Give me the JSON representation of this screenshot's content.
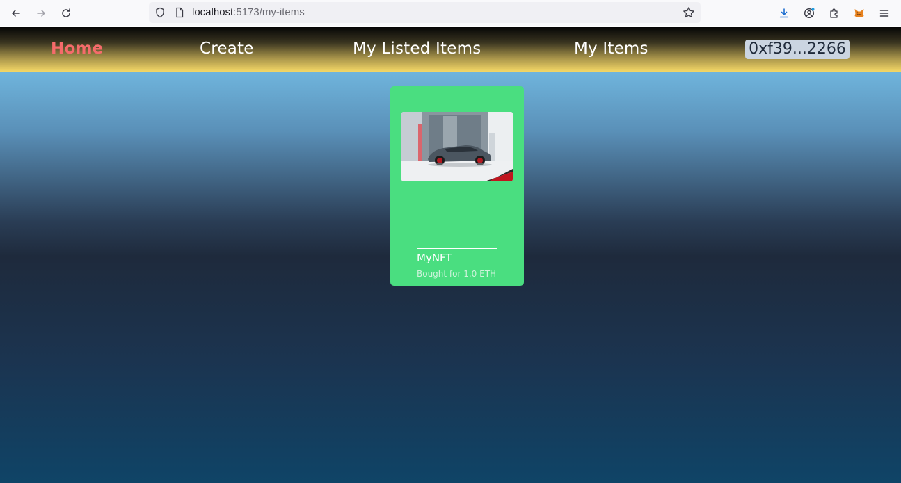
{
  "browser": {
    "url_host": "localhost",
    "url_path": ":5173/my-items"
  },
  "navbar": {
    "items": [
      {
        "label": "Home",
        "active": true
      },
      {
        "label": "Create",
        "active": false
      },
      {
        "label": "My Listed Items",
        "active": false
      },
      {
        "label": "My Items",
        "active": false
      }
    ],
    "wallet_label": "0xf39...2266"
  },
  "items": [
    {
      "title": "MyNFT",
      "price_text": "Bought for 1.0 ETH",
      "image_icon": "car-photo"
    }
  ],
  "colors": {
    "card": "#4ade80",
    "active_link": "#f56b6b",
    "wallet_bg": "#cbd5e1"
  }
}
